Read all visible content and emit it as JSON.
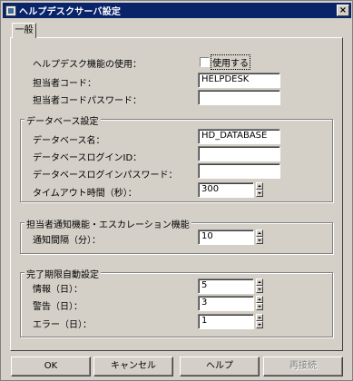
{
  "window": {
    "title": "ヘルプデスクサーバ設定",
    "close_glyph": "×"
  },
  "tabs": {
    "general": "一般"
  },
  "general": {
    "use_feature_label": "ヘルプデスク機能の使用：",
    "use_feature_checkbox_label": "使用する",
    "use_feature_checked": false,
    "staff_code_label": "担当者コード：",
    "staff_code_value": "HELPDESK",
    "staff_password_label": "担当者コードパスワード：",
    "staff_password_value": ""
  },
  "database": {
    "group_title": "データベース設定",
    "name_label": "データベース名：",
    "name_value": "HD_DATABASE",
    "login_id_label": "データベースログインID：",
    "login_id_value": "",
    "login_password_label": "データベースログインパスワード：",
    "login_password_value": "",
    "timeout_label": "タイムアウト時間（秒）：",
    "timeout_value": "300"
  },
  "escalation": {
    "group_title": "担当者通知機能・エスカレーション機能",
    "interval_label": "通知間隔（分）：",
    "interval_value": "10"
  },
  "expiry": {
    "group_title": "完了期限自動設定",
    "info_label": "情報（日）：",
    "info_value": "5",
    "warning_label": "警告（日）：",
    "warning_value": "3",
    "error_label": "エラー（日）：",
    "error_value": "1"
  },
  "buttons": {
    "ok": "OK",
    "cancel": "キャンセル",
    "help": "ヘルプ",
    "reconnect": "再接続"
  }
}
